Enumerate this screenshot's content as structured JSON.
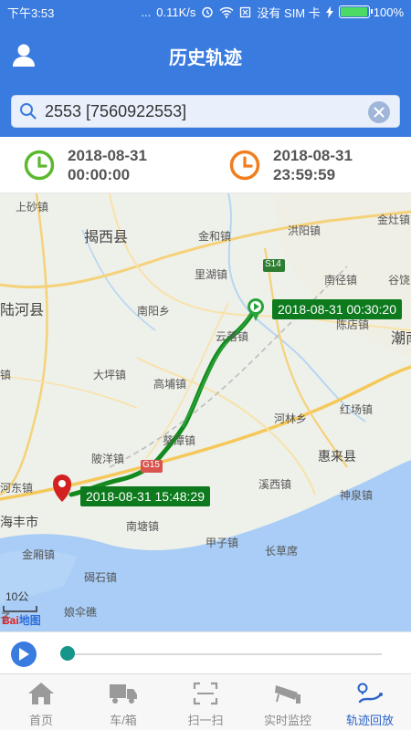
{
  "status_bar": {
    "time": "下午3:53",
    "dots": "...",
    "network_speed": "0.11K/s",
    "no_sim": "没有 SIM 卡",
    "battery": "100%"
  },
  "header": {
    "title": "历史轨迹"
  },
  "search": {
    "value": "2553 [7560922553]",
    "placeholder": ""
  },
  "time_range": {
    "start": {
      "date": "2018-08-31",
      "time": "00:00:00",
      "color": "#5cb82e"
    },
    "end": {
      "date": "2018-08-31",
      "time": "23:59:59",
      "color": "#f07d1e"
    }
  },
  "map": {
    "start_marker_label": "2018-08-31 00:30:20",
    "end_marker_label": "2018-08-31 15:48:29",
    "route_color": "#138a1d",
    "scale_text": "10公",
    "logo_text": "Bai",
    "logo_suffix": "地图",
    "places": {
      "p1": "上砂镇",
      "p2": "揭西县",
      "p3": "金和镇",
      "p4": "洪阳镇",
      "p5": "金灶镇",
      "p6": "里湖镇",
      "p7": "南径镇",
      "p8": "谷饶",
      "p9": "陆河县",
      "p10": "南阳乡",
      "p11": "陈店镇",
      "p12": "潮南",
      "p13": "云落镇",
      "p14": "大坪镇",
      "p15": "高埔镇",
      "p16": "红场镇",
      "p17": "河林乡",
      "p18": "葵潭镇",
      "p19": "惠来县",
      "p20": "陂洋镇",
      "p21": "溪西镇",
      "p22": "河东镇",
      "p23": "神泉镇",
      "p24": "海丰市",
      "p25": "南塘镇",
      "p26": "甲子镇",
      "p27": "长草席",
      "p28": "金厢镇",
      "p29": "碣石镇",
      "p30": "娘伞礁",
      "p31": "S14",
      "p32": "G15",
      "p33": "镇",
      "p34": "子"
    }
  },
  "player": {
    "progress": 0.0
  },
  "tabs": [
    {
      "label": "首页",
      "icon": "home-icon"
    },
    {
      "label": "车/箱",
      "icon": "truck-icon"
    },
    {
      "label": "扫一扫",
      "icon": "scan-icon"
    },
    {
      "label": "实时监控",
      "icon": "camera-icon"
    },
    {
      "label": "轨迹回放",
      "icon": "track-replay-icon",
      "active": true
    }
  ]
}
